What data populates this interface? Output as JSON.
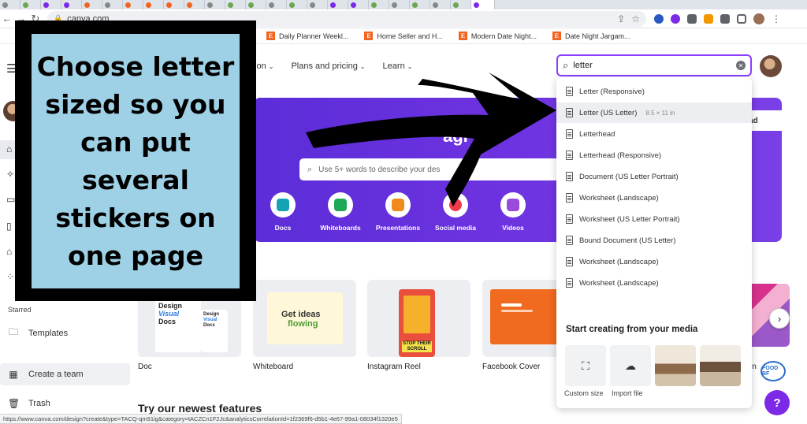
{
  "browser": {
    "url": "canva.com",
    "bookmarks": [
      "Daily Planner Weekl...",
      "Home Seller and H...",
      "Modern Date Night...",
      "Date Night Jargam..."
    ],
    "status_url": "https://www.canva.com/design?create&type=TACQ-qm91ig&category=tACZCn1F2Jc&analyticsCorrelationId=1f2369f6-d5b1-4e67-99a1-08034f1320e5"
  },
  "canva": {
    "nav": [
      "tion",
      "Plans and pricing",
      "Learn"
    ],
    "search_query": "letter",
    "suggestions": [
      {
        "label": "Letter (Responsive)",
        "dim": ""
      },
      {
        "label": "Letter (US Letter)",
        "dim": "8.5 × 11 in"
      },
      {
        "label": "Letterhead",
        "dim": ""
      },
      {
        "label": "Letterhead (Responsive)",
        "dim": ""
      },
      {
        "label": "Document (US Letter Portrait)",
        "dim": ""
      },
      {
        "label": "Worksheet (Landscape)",
        "dim": ""
      },
      {
        "label": "Worksheet (US Letter Portrait)",
        "dim": ""
      },
      {
        "label": "Bound Document (US Letter)",
        "dim": ""
      },
      {
        "label": "Worksheet (Landscape)",
        "dim": ""
      },
      {
        "label": "Worksheet (Landscape)",
        "dim": ""
      }
    ],
    "media_title": "Start creating from your media",
    "media_actions": [
      "Custom size",
      "Import file"
    ],
    "hero": {
      "title_partial": "agi",
      "upload_partial": "oad",
      "search_placeholder": "Use 5+ words to describe your des",
      "categories": [
        "Docs",
        "Whiteboards",
        "Presentations",
        "Social media",
        "Videos"
      ]
    },
    "sidebar": {
      "starred": "Starred",
      "templates": "Templates",
      "create_team": "Create a team",
      "trash": "Trash"
    },
    "templates": [
      {
        "label": "Doc"
      },
      {
        "label": "Whiteboard"
      },
      {
        "label": "Instagram Reel"
      },
      {
        "label": "Facebook Cover"
      }
    ],
    "card_texts": {
      "doc_a": "Design",
      "doc_b": "Visual",
      "doc_c": "Docs",
      "wb_a": "Get ideas",
      "wb_b": "flowing",
      "reel": "STOP THEIR SCROLL"
    },
    "features_heading": "Try our newest features",
    "partial_label": "in",
    "help": "?",
    "badge": "FOOD BF"
  },
  "annotation": {
    "text": "Choose letter sized so you can put several stickers on one page",
    "lines": [
      "Choose letter",
      "sized so you",
      "can put",
      "several",
      "stickers on",
      "one page"
    ]
  },
  "colors": {
    "accent": "#8b3dff",
    "hero": "#6d32e0",
    "note_bg": "#9fd1e6",
    "etsy": "#f16521"
  }
}
